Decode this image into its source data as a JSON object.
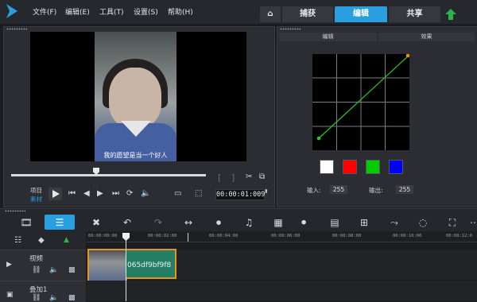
{
  "menu": [
    "文件(F)",
    "编辑(E)",
    "工具(T)",
    "设置(S)",
    "帮助(H)"
  ],
  "tabs": [
    "捕获",
    "编辑",
    "共享"
  ],
  "right_panel_tabs": [
    "编辑",
    "效果"
  ],
  "subtitle": "我的愿望是当一个好人",
  "timecode": "00:00:01:009",
  "mode_labels": [
    "项目",
    "素材"
  ],
  "io": {
    "input_label": "输入:",
    "input_value": "255",
    "output_label": "输出:",
    "output_value": "255"
  },
  "swatch_colors": [
    "#ffffff",
    "#ff0000",
    "#00cc00",
    "#0000ff"
  ],
  "ruler_ticks": [
    "00:00:00:00",
    "00:00:02:00",
    "00:00:04:00",
    "00:00:06:00",
    "00:00:08:00",
    "00:00:10:00",
    "00:00:12:0"
  ],
  "tracks": [
    {
      "name": "视频"
    },
    {
      "name": "叠加1"
    }
  ],
  "clip_label": "065df9bf9f8",
  "accent": "#2a9fe0"
}
